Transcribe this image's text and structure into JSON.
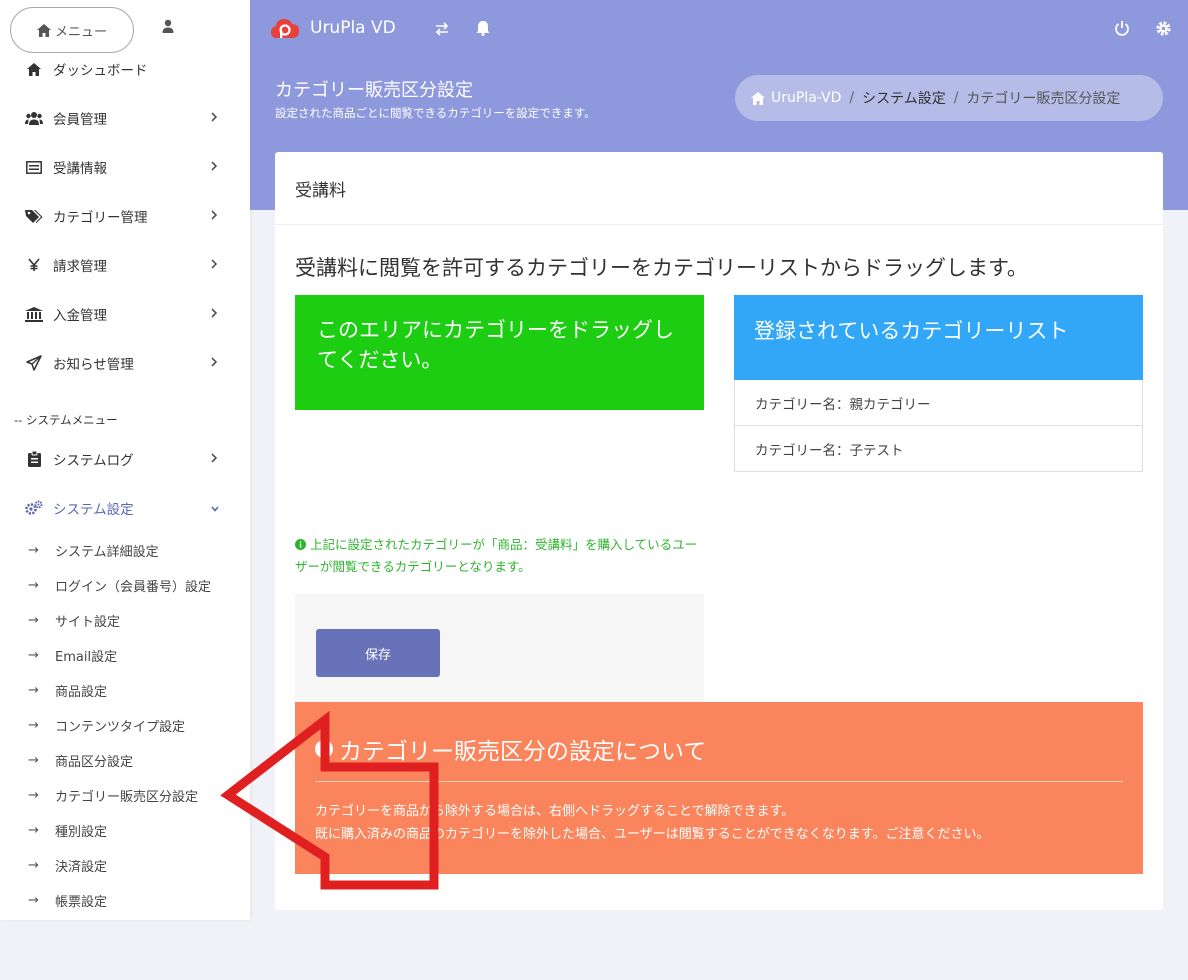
{
  "sidebar": {
    "menu_label": "メニュー",
    "items": [
      {
        "label": "ダッシュボード",
        "icon": "home-icon"
      },
      {
        "label": "会員管理",
        "icon": "users-icon"
      },
      {
        "label": "受講情報",
        "icon": "list-icon"
      },
      {
        "label": "カテゴリー管理",
        "icon": "tags-icon"
      },
      {
        "label": "請求管理",
        "icon": "yen-icon"
      },
      {
        "label": "入金管理",
        "icon": "bank-icon"
      },
      {
        "label": "お知らせ管理",
        "icon": "send-icon"
      }
    ],
    "system_heading": "-- システムメニュー",
    "system_items": [
      {
        "label": "システムログ",
        "icon": "clipboard-icon"
      },
      {
        "label": "システム設定",
        "icon": "cogs-icon"
      }
    ],
    "sub_items": [
      "システム詳細設定",
      "ログイン（会員番号）設定",
      "サイト設定",
      "Email設定",
      "商品設定",
      "コンテンツタイプ設定",
      "商品区分設定",
      "カテゴリー販売区分設定",
      "種別設定",
      "決済設定",
      "帳票設定"
    ],
    "sub_arrow": "→"
  },
  "header": {
    "brand": "UruPla VD",
    "brand_color": "#e8413a",
    "bar_color": "#8e98dc"
  },
  "page": {
    "title": "カテゴリー販売区分設定",
    "subtitle": "設定された商品ごとに閲覧できるカテゴリーを設定できます。",
    "breadcrumb": [
      "UruPla-VD",
      "システム設定",
      "カテゴリー販売区分設定"
    ]
  },
  "card": {
    "title": "受講料",
    "instruction": "受講料に閲覧を許可するカテゴリーをカテゴリーリストからドラッグします。",
    "drop_area_text": "このエリアにカテゴリーをドラッグしてください。",
    "list_heading": "登録されているカテゴリーリスト",
    "categories": [
      "カテゴリー名：親カテゴリー",
      "カテゴリー名：子テスト"
    ],
    "note": "上記に設定されたカテゴリーが「商品：受講料」を購入しているユーザーが閲覧できるカテゴリーとなります。",
    "save_label": "保存"
  },
  "info": {
    "title": "カテゴリー販売区分の設定について",
    "line1": "カテゴリーを商品から除外する場合は、右側へドラッグすることで解除できます。",
    "line2": "既に購入済みの商品のカテゴリーを除外した場合、ユーザーは閲覧することができなくなります。ご注意ください。",
    "color": "#fa845c"
  }
}
